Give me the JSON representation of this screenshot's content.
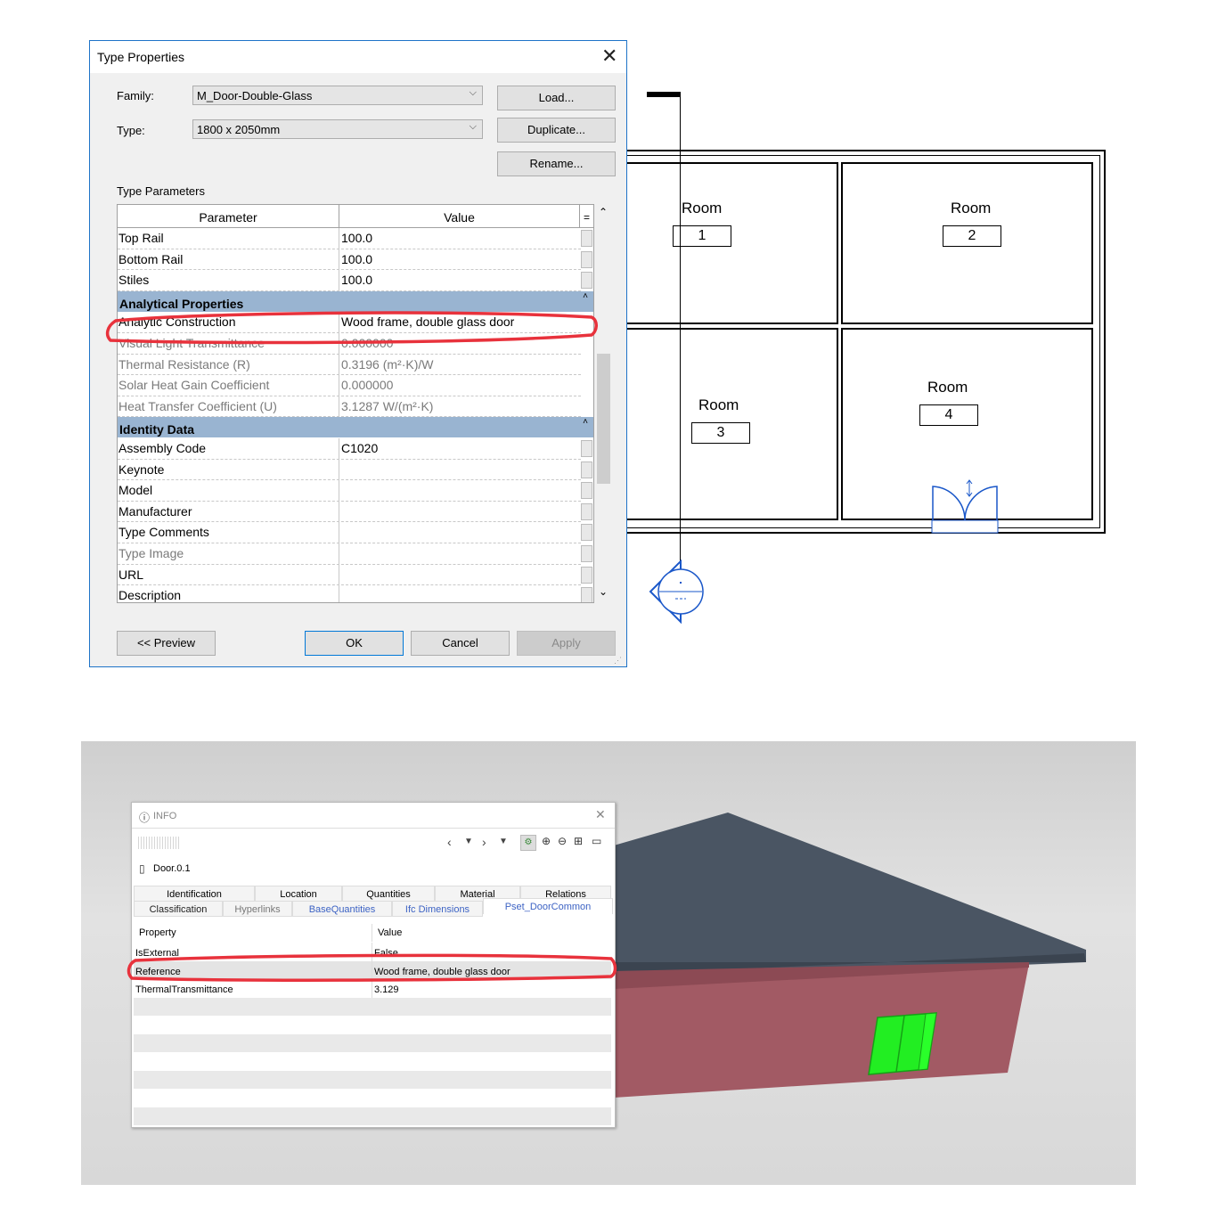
{
  "type_properties": {
    "title": "Type Properties",
    "family_label": "Family:",
    "family_value": "M_Door-Double-Glass",
    "type_label": "Type:",
    "type_value": "1800 x 2050mm",
    "load_button": "Load...",
    "duplicate_button": "Duplicate...",
    "rename_button": "Rename...",
    "type_parameters_label": "Type Parameters",
    "col_parameter": "Parameter",
    "col_value": "Value",
    "col_sort": "=",
    "rows_top": [
      {
        "p": "Top Rail",
        "v": "100.0"
      },
      {
        "p": "Bottom Rail",
        "v": "100.0"
      },
      {
        "p": "Stiles",
        "v": "100.0"
      }
    ],
    "section_analytical": "Analytical Properties",
    "rows_analytical": [
      {
        "p": "Analytic Construction",
        "v": "Wood frame, double glass door"
      },
      {
        "p": "Visual Light Transmittance",
        "v": "0.000000"
      },
      {
        "p": "Thermal Resistance (R)",
        "v": "0.3196 (m²·K)/W"
      },
      {
        "p": "Solar Heat Gain Coefficient",
        "v": "0.000000"
      },
      {
        "p": "Heat Transfer Coefficient (U)",
        "v": "3.1287 W/(m²·K)"
      }
    ],
    "section_identity": "Identity Data",
    "rows_identity": [
      {
        "p": "Assembly Code",
        "v": "C1020"
      },
      {
        "p": "Keynote",
        "v": ""
      },
      {
        "p": "Model",
        "v": ""
      },
      {
        "p": "Manufacturer",
        "v": ""
      },
      {
        "p": "Type Comments",
        "v": ""
      },
      {
        "p": "Type Image",
        "v": ""
      },
      {
        "p": "URL",
        "v": ""
      },
      {
        "p": "Description",
        "v": ""
      }
    ],
    "preview_button": "<< Preview",
    "ok_button": "OK",
    "cancel_button": "Cancel",
    "apply_button": "Apply"
  },
  "floor_plan": {
    "room_label": "Room",
    "room_numbers": [
      "1",
      "2",
      "3",
      "4"
    ]
  },
  "info_panel": {
    "title": "INFO",
    "element_name": "Door.0.1",
    "tabs_row1": [
      "Identification",
      "Location",
      "Quantities",
      "Material",
      "Relations"
    ],
    "tabs_row2": [
      "Classification",
      "Hyperlinks",
      "BaseQuantities",
      "Ifc Dimensions",
      "Pset_DoorCommon"
    ],
    "col_property": "Property",
    "col_value": "Value",
    "rows": [
      {
        "p": "IsExternal",
        "v": "False"
      },
      {
        "p": "Reference",
        "v": "Wood frame, double glass door"
      },
      {
        "p": "ThermalTransmittance",
        "v": "3.129"
      }
    ]
  },
  "colors": {
    "dialog_border": "#1e73c8",
    "section_header": "#99b4d1",
    "highlight_marker": "#e8323c",
    "plan_door": "#1a57c9",
    "roof": "#4a5563",
    "wall_3d": "#a25a64",
    "door_3d": "#22ee22"
  }
}
